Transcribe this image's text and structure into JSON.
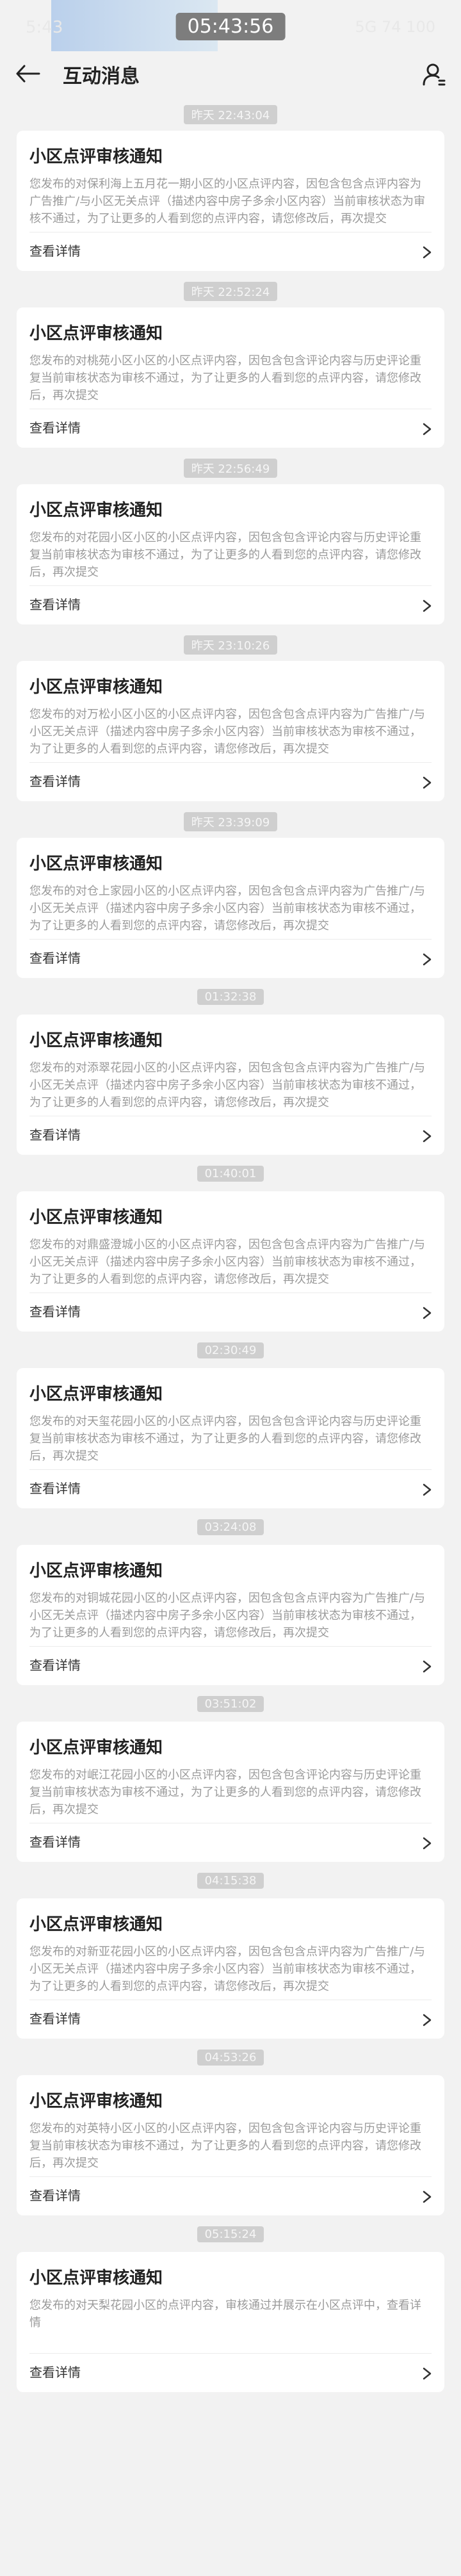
{
  "status_bar": {
    "time_left": "5:43",
    "clock": "05:43:56",
    "right_indicators": "5G 74 100"
  },
  "header": {
    "title": "互动消息"
  },
  "messages": [
    {
      "time": "昨天 22:43:04",
      "title": "小区点评审核通知",
      "body": "您发布的对保利海上五月花一期小区的小区点评内容，因包含包含点评内容为广告推广/与小区无关点评（描述内容中房子多余小区内容）当前审核状态为审核不通过，为了让更多的人看到您的点评内容，请您修改后，再次提交",
      "link": "查看详情"
    },
    {
      "time": "昨天 22:52:24",
      "title": "小区点评审核通知",
      "body": "您发布的对桃苑小区小区的小区点评内容，因包含包含评论内容与历史评论重复当前审核状态为审核不通过，为了让更多的人看到您的点评内容，请您修改后，再次提交",
      "link": "查看详情"
    },
    {
      "time": "昨天 22:56:49",
      "title": "小区点评审核通知",
      "body": "您发布的对花园小区小区的小区点评内容，因包含包含评论内容与历史评论重复当前审核状态为审核不通过，为了让更多的人看到您的点评内容，请您修改后，再次提交",
      "link": "查看详情"
    },
    {
      "time": "昨天 23:10:26",
      "title": "小区点评审核通知",
      "body": "您发布的对万松小区小区的小区点评内容，因包含包含点评内容为广告推广/与小区无关点评（描述内容中房子多余小区内容）当前审核状态为审核不通过，为了让更多的人看到您的点评内容，请您修改后，再次提交",
      "link": "查看详情"
    },
    {
      "time": "昨天 23:39:09",
      "title": "小区点评审核通知",
      "body": "您发布的对仓上家园小区的小区点评内容，因包含包含点评内容为广告推广/与小区无关点评（描述内容中房子多余小区内容）当前审核状态为审核不通过，为了让更多的人看到您的点评内容，请您修改后，再次提交",
      "link": "查看详情"
    },
    {
      "time": "01:32:38",
      "title": "小区点评审核通知",
      "body": "您发布的对添翠花园小区的小区点评内容，因包含包含点评内容为广告推广/与小区无关点评（描述内容中房子多余小区内容）当前审核状态为审核不通过，为了让更多的人看到您的点评内容，请您修改后，再次提交",
      "link": "查看详情"
    },
    {
      "time": "01:40:01",
      "title": "小区点评审核通知",
      "body": "您发布的对鼎盛澄城小区的小区点评内容，因包含包含点评内容为广告推广/与小区无关点评（描述内容中房子多余小区内容）当前审核状态为审核不通过，为了让更多的人看到您的点评内容，请您修改后，再次提交",
      "link": "查看详情"
    },
    {
      "time": "02:30:49",
      "title": "小区点评审核通知",
      "body": "您发布的对天玺花园小区的小区点评内容，因包含包含评论内容与历史评论重复当前审核状态为审核不通过，为了让更多的人看到您的点评内容，请您修改后，再次提交",
      "link": "查看详情"
    },
    {
      "time": "03:24:08",
      "title": "小区点评审核通知",
      "body": "您发布的对铜城花园小区的小区点评内容，因包含包含点评内容为广告推广/与小区无关点评（描述内容中房子多余小区内容）当前审核状态为审核不通过，为了让更多的人看到您的点评内容，请您修改后，再次提交",
      "link": "查看详情"
    },
    {
      "time": "03:51:02",
      "title": "小区点评审核通知",
      "body": "您发布的对岷江花园小区的小区点评内容，因包含包含评论内容与历史评论重复当前审核状态为审核不通过，为了让更多的人看到您的点评内容，请您修改后，再次提交",
      "link": "查看详情"
    },
    {
      "time": "04:15:38",
      "title": "小区点评审核通知",
      "body": "您发布的对新亚花园小区的小区点评内容，因包含包含点评内容为广告推广/与小区无关点评（描述内容中房子多余小区内容）当前审核状态为审核不通过，为了让更多的人看到您的点评内容，请您修改后，再次提交",
      "link": "查看详情"
    },
    {
      "time": "04:53:26",
      "title": "小区点评审核通知",
      "body": "您发布的对英特小区小区的小区点评内容，因包含包含评论内容与历史评论重复当前审核状态为审核不通过，为了让更多的人看到您的点评内容，请您修改后，再次提交",
      "link": "查看详情"
    },
    {
      "time": "05:15:24",
      "title": "小区点评审核通知",
      "body": "您发布的对天梨花园小区的点评内容，审核通过并展示在小区点评中，查看详情",
      "link": "查看详情"
    }
  ],
  "colors": {
    "background": "#f2f2f2",
    "card": "#ffffff",
    "time_pill": "#cfcfcf",
    "body_text": "#9a9a9a"
  },
  "icons": {
    "back": "back-arrow-icon",
    "user": "user-icon",
    "chevron": "chevron-right-icon"
  }
}
